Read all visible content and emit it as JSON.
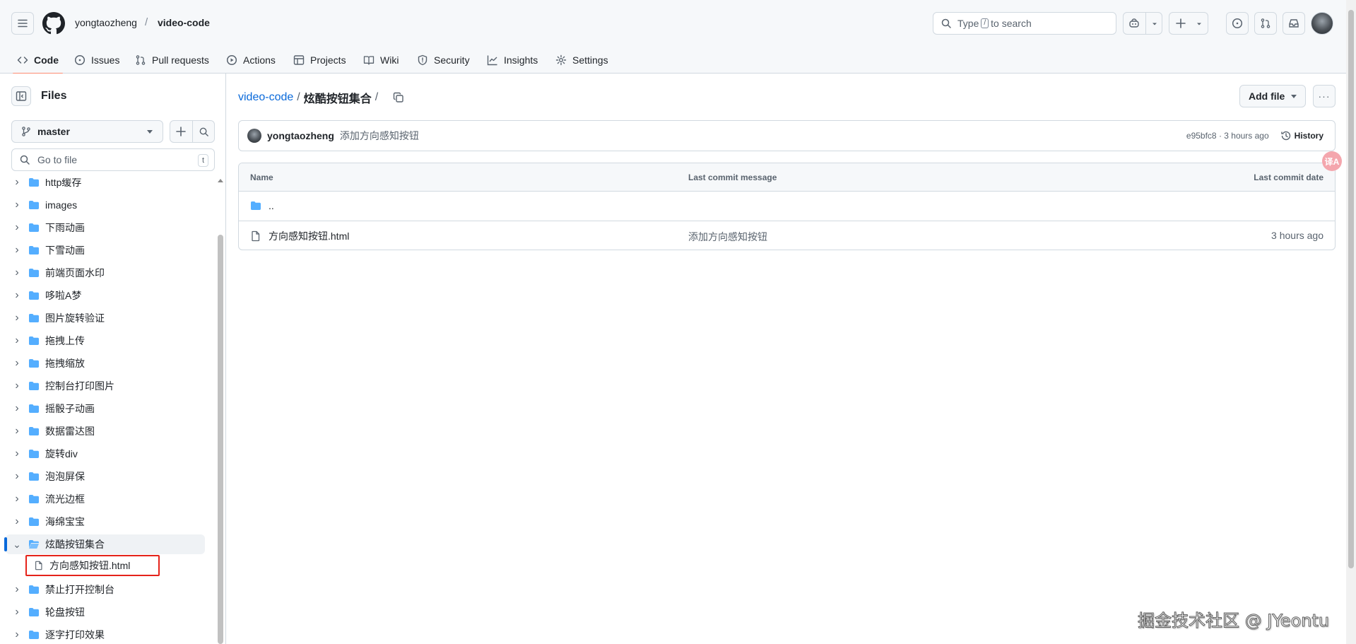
{
  "header": {
    "owner": "yongtaozheng",
    "separator": "/",
    "repo": "video-code",
    "search": {
      "prefix": "Type",
      "key": "/",
      "suffix": "to search"
    }
  },
  "tabs": [
    {
      "label": "Code",
      "icon": "code-icon",
      "active": true
    },
    {
      "label": "Issues",
      "icon": "issue-icon"
    },
    {
      "label": "Pull requests",
      "icon": "pull-request-icon"
    },
    {
      "label": "Actions",
      "icon": "play-icon"
    },
    {
      "label": "Projects",
      "icon": "table-icon"
    },
    {
      "label": "Wiki",
      "icon": "book-icon"
    },
    {
      "label": "Security",
      "icon": "shield-icon"
    },
    {
      "label": "Insights",
      "icon": "graph-icon"
    },
    {
      "label": "Settings",
      "icon": "gear-icon"
    }
  ],
  "sidebar": {
    "title": "Files",
    "branch": "master",
    "goto_placeholder": "Go to file",
    "goto_shortcut": "t",
    "tree": [
      {
        "label": "http缓存"
      },
      {
        "label": "images"
      },
      {
        "label": "下雨动画"
      },
      {
        "label": "下雪动画"
      },
      {
        "label": "前端页面水印"
      },
      {
        "label": "哆啦A梦"
      },
      {
        "label": "图片旋转验证"
      },
      {
        "label": "拖拽上传"
      },
      {
        "label": "拖拽缩放"
      },
      {
        "label": "控制台打印图片"
      },
      {
        "label": "摇骰子动画"
      },
      {
        "label": "数据雷达图"
      },
      {
        "label": "旋转div"
      },
      {
        "label": "泡泡屏保"
      },
      {
        "label": "流光边框"
      },
      {
        "label": "海绵宝宝"
      },
      {
        "label": "炫酷按钮集合",
        "expanded": true,
        "selected": true
      },
      {
        "label": "禁止打开控制台"
      },
      {
        "label": "轮盘按钮"
      },
      {
        "label": "逐字打印效果"
      }
    ],
    "selected_file": "方向感知按钮.html"
  },
  "main": {
    "path_repo": "video-code",
    "path_sep": "/",
    "path_dir": "炫酷按钮集合",
    "path_trail": "/",
    "add_file": "Add file",
    "more": "···",
    "commit": {
      "author": "yongtaozheng",
      "message": "添加方向感知按钮",
      "hash_time": "e95bfc8 · 3 hours ago",
      "history": "History"
    },
    "table": {
      "headers": [
        "Name",
        "Last commit message",
        "Last commit date"
      ],
      "parent": "..",
      "rows": [
        {
          "name": "方向感知按钮.html",
          "message": "添加方向感知按钮",
          "date": "3 hours ago"
        }
      ]
    }
  },
  "overlay": {
    "translate_badge": "译A",
    "watermark": "掘金技术社区 @ JYeontu"
  },
  "colors": {
    "accent": "#0969da",
    "tab_underline": "#fd8c73",
    "folder": "#54aeff",
    "highlight_box": "#e5231a"
  }
}
